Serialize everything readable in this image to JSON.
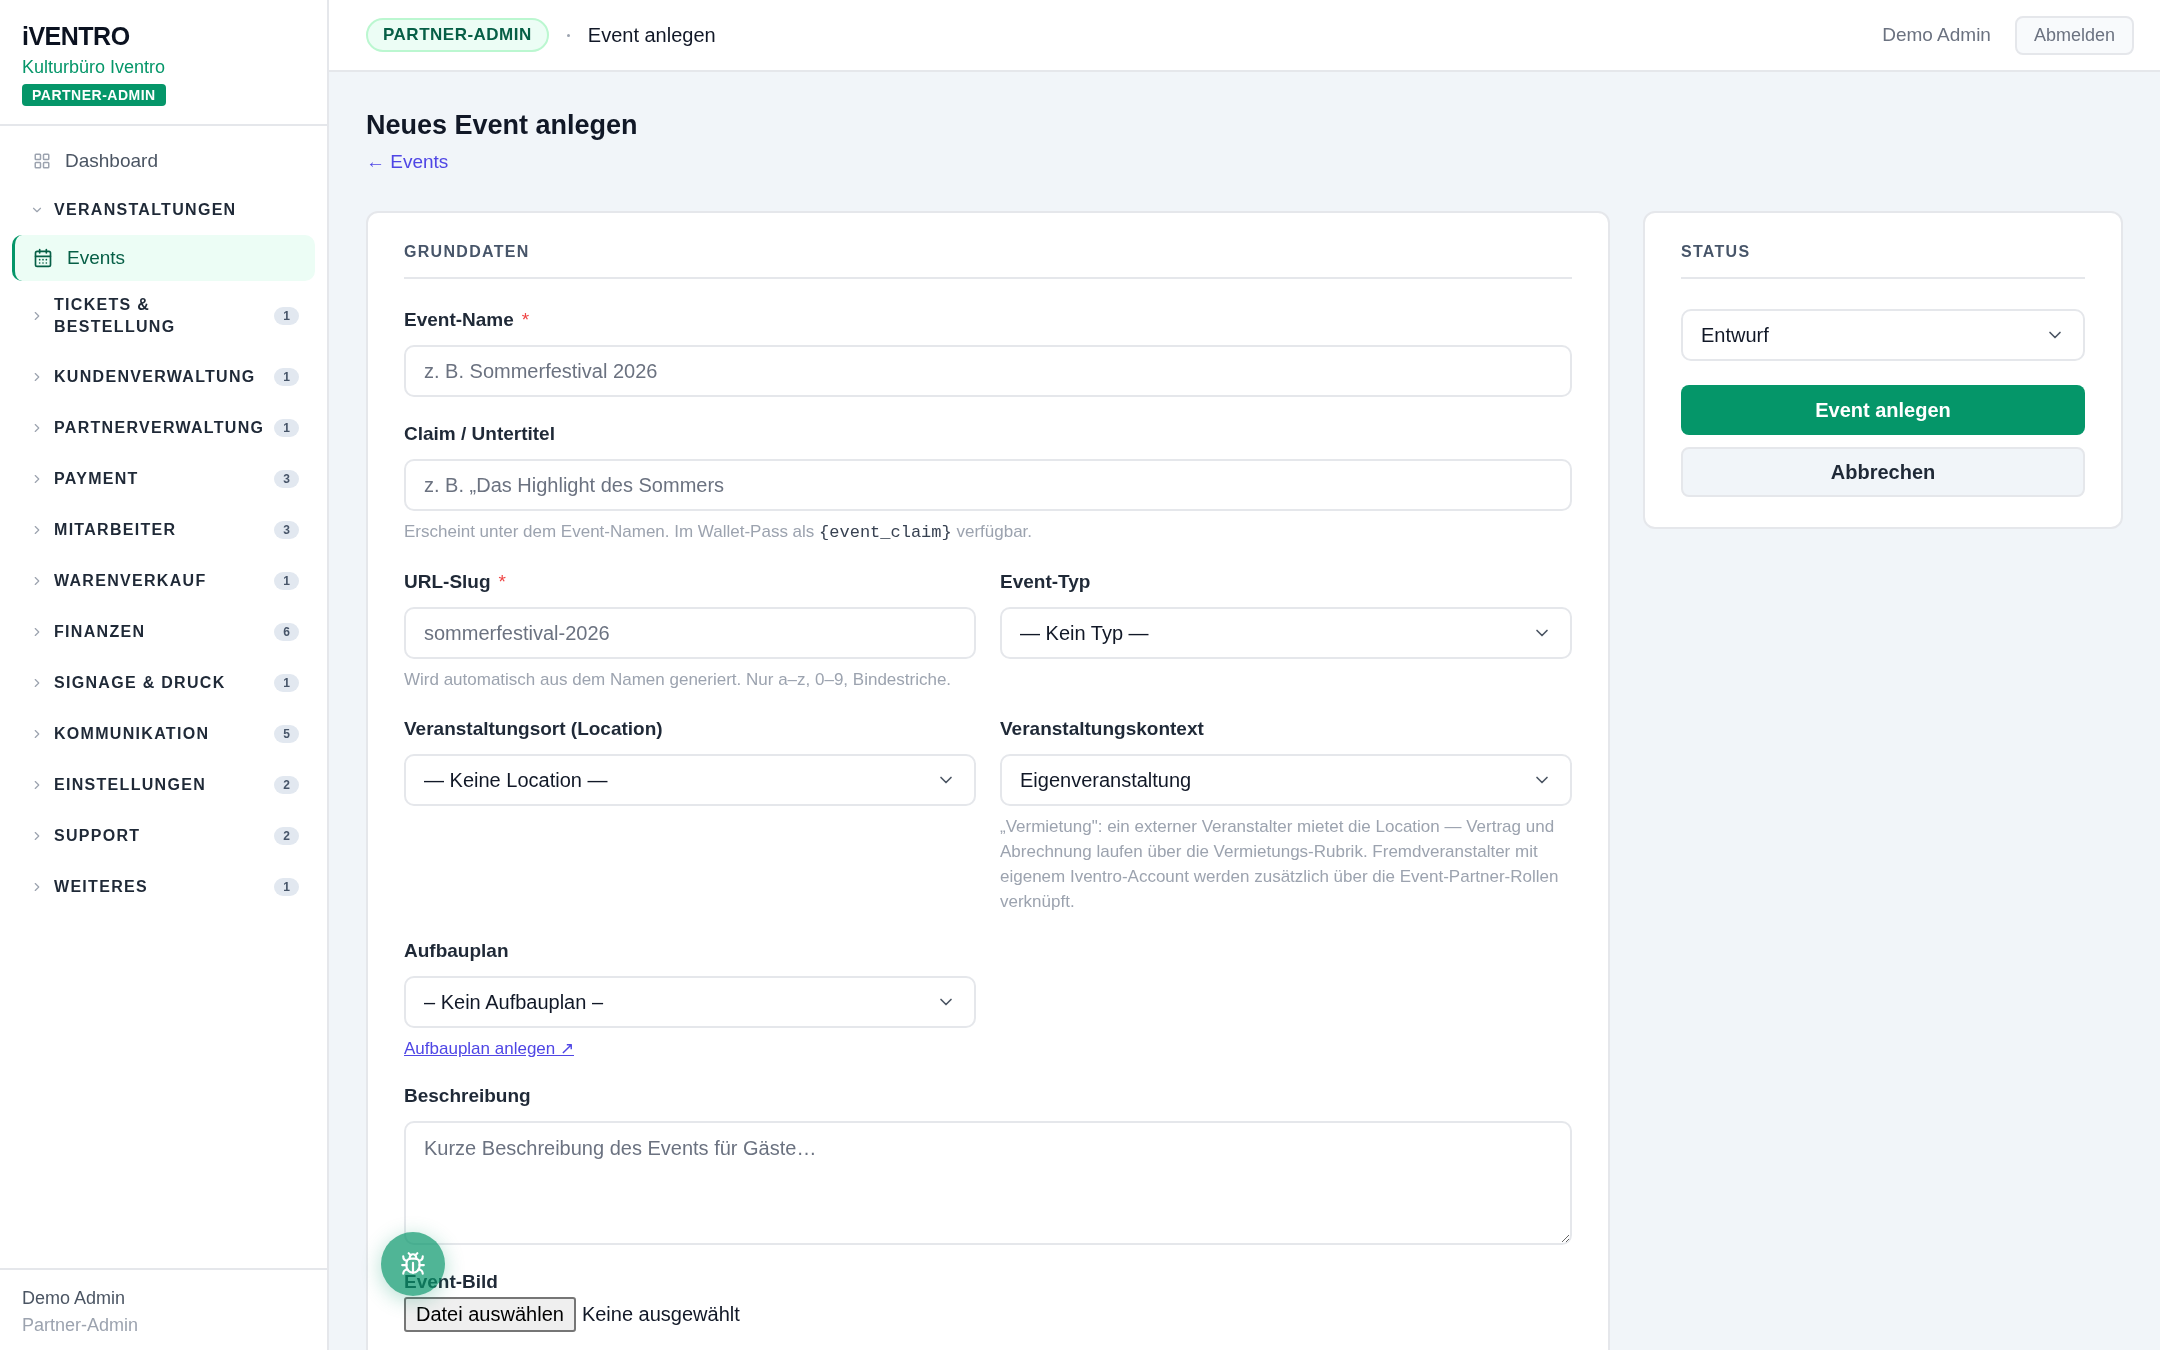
{
  "brand": {
    "logo": "iVENTRO",
    "org": "Kulturbüro Iventro",
    "role_badge": "PARTNER-ADMIN"
  },
  "sidebar": {
    "nav": [
      {
        "kind": "link",
        "label": "Dashboard",
        "selected": false
      },
      {
        "kind": "group",
        "label": "VERANSTALTUNGEN",
        "expanded": true,
        "children": [
          {
            "label": "Events",
            "selected": true
          }
        ]
      },
      {
        "kind": "group",
        "label": "TICKETS & BESTELLUNG",
        "expanded": false,
        "count": "1"
      },
      {
        "kind": "group",
        "label": "KUNDENVERWALTUNG",
        "expanded": false,
        "count": "1"
      },
      {
        "kind": "group",
        "label": "PARTNERVERWALTUNG",
        "expanded": false,
        "count": "1"
      },
      {
        "kind": "group",
        "label": "PAYMENT",
        "expanded": false,
        "count": "3"
      },
      {
        "kind": "group",
        "label": "MITARBEITER",
        "expanded": false,
        "count": "3"
      },
      {
        "kind": "group",
        "label": "WARENVERKAUF",
        "expanded": false,
        "count": "1"
      },
      {
        "kind": "group",
        "label": "FINANZEN",
        "expanded": false,
        "count": "6"
      },
      {
        "kind": "group",
        "label": "SIGNAGE & DRUCK",
        "expanded": false,
        "count": "1"
      },
      {
        "kind": "group",
        "label": "KOMMUNIKATION",
        "expanded": false,
        "count": "5"
      },
      {
        "kind": "group",
        "label": "EINSTELLUNGEN",
        "expanded": false,
        "count": "2"
      },
      {
        "kind": "group",
        "label": "SUPPORT",
        "expanded": false,
        "count": "2"
      },
      {
        "kind": "group",
        "label": "WEITERES",
        "expanded": false,
        "count": "1"
      }
    ],
    "user": {
      "name": "Demo Admin",
      "role": "Partner-Admin"
    }
  },
  "header": {
    "badge": "PARTNER-ADMIN",
    "page": "Event anlegen",
    "user": "Demo Admin",
    "logout": "Abmelden"
  },
  "page": {
    "title": "Neues Event anlegen",
    "back_link": "← Events"
  },
  "form": {
    "section": "GRUNDDATEN",
    "rows": [
      [
        {
          "kind": "text",
          "label": "Event-Name",
          "required_mark": "*",
          "placeholder": "z. B. Sommerfestival 2026"
        }
      ],
      [
        {
          "kind": "text",
          "label": "Claim / Untertitel",
          "placeholder": "z. B. „Das Highlight des Sommers",
          "hint": [
            {
              "kind": "plain",
              "text": "Erscheint unter dem Event-Namen. Im Wallet-Pass als "
            },
            {
              "kind": "code",
              "text": "{event_claim}"
            },
            {
              "kind": "plain",
              "text": " verfügbar."
            }
          ]
        }
      ],
      [
        {
          "kind": "text",
          "label": "URL-Slug",
          "required_mark": "*",
          "placeholder": "sommerfestival-2026",
          "hint": [
            {
              "kind": "plain",
              "text": "Wird automatisch aus dem Namen generiert. Nur a–z, 0–9, Bindestriche."
            }
          ]
        },
        {
          "kind": "select",
          "label": "Event-Typ",
          "value": "— Kein Typ —"
        }
      ],
      [
        {
          "kind": "select",
          "label": "Veranstaltungsort (Location)",
          "value": "— Keine Location —"
        },
        {
          "kind": "select",
          "label": "Veranstaltungskontext",
          "value": "Eigenveranstaltung",
          "hint": [
            {
              "kind": "plain",
              "text": "„Vermietung\": ein externer Veranstalter mietet die Location — Vertrag und Abrechnung laufen über die Vermietungs-Rubrik. Fremdveranstalter mit eigenem Iventro-Account werden zusätzlich über die Event-Partner-Rollen verknüpft."
            }
          ]
        }
      ],
      [
        {
          "kind": "select",
          "label": "Aufbauplan",
          "value": "– Kein Aufbauplan –",
          "link": "Aufbauplan anlegen ↗"
        },
        {
          "kind": "empty"
        }
      ],
      [
        {
          "kind": "textarea",
          "label": "Beschreibung",
          "placeholder": "Kurze Beschreibung des Events für Gäste…"
        }
      ],
      [
        {
          "kind": "file",
          "label": "Event-Bild",
          "button": "Datei auswählen",
          "value": "Keine ausgewählt"
        }
      ]
    ]
  },
  "status_card": {
    "title": "STATUS",
    "select": "Entwurf",
    "primary": "Event anlegen",
    "secondary": "Abbrechen"
  }
}
